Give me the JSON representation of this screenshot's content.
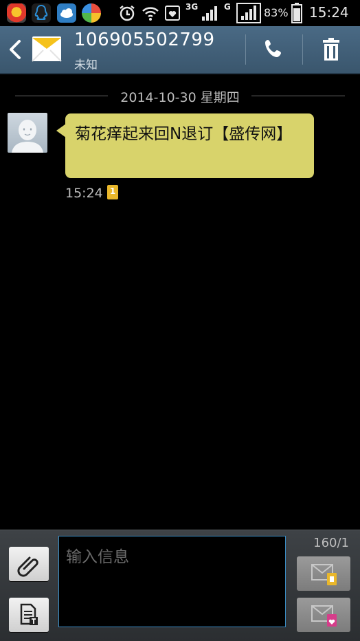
{
  "status_bar": {
    "network_3g": "3G",
    "network_g": "G",
    "battery_percent": "83%",
    "time": "15:24"
  },
  "header": {
    "contact_number": "106905502799",
    "contact_name": "未知"
  },
  "conversation": {
    "date": "2014-10-30 星期四",
    "messages": [
      {
        "text": "菊花痒起来回N退订【盛传网】",
        "time": "15:24",
        "sim_label": "1"
      }
    ]
  },
  "compose": {
    "placeholder": "输入信息",
    "char_count": "160/1"
  },
  "icons": {
    "back": "back-arrow-icon",
    "envelope": "envelope-icon",
    "call": "phone-icon",
    "delete": "trash-icon",
    "attach": "paperclip-icon",
    "template": "template-icon",
    "send_sim1": "send-sim1-icon",
    "send_sim2": "send-sim2-icon"
  },
  "colors": {
    "header": "#3f5c74",
    "bubble": "#d8d36b",
    "input_border": "#3b8ec6"
  }
}
